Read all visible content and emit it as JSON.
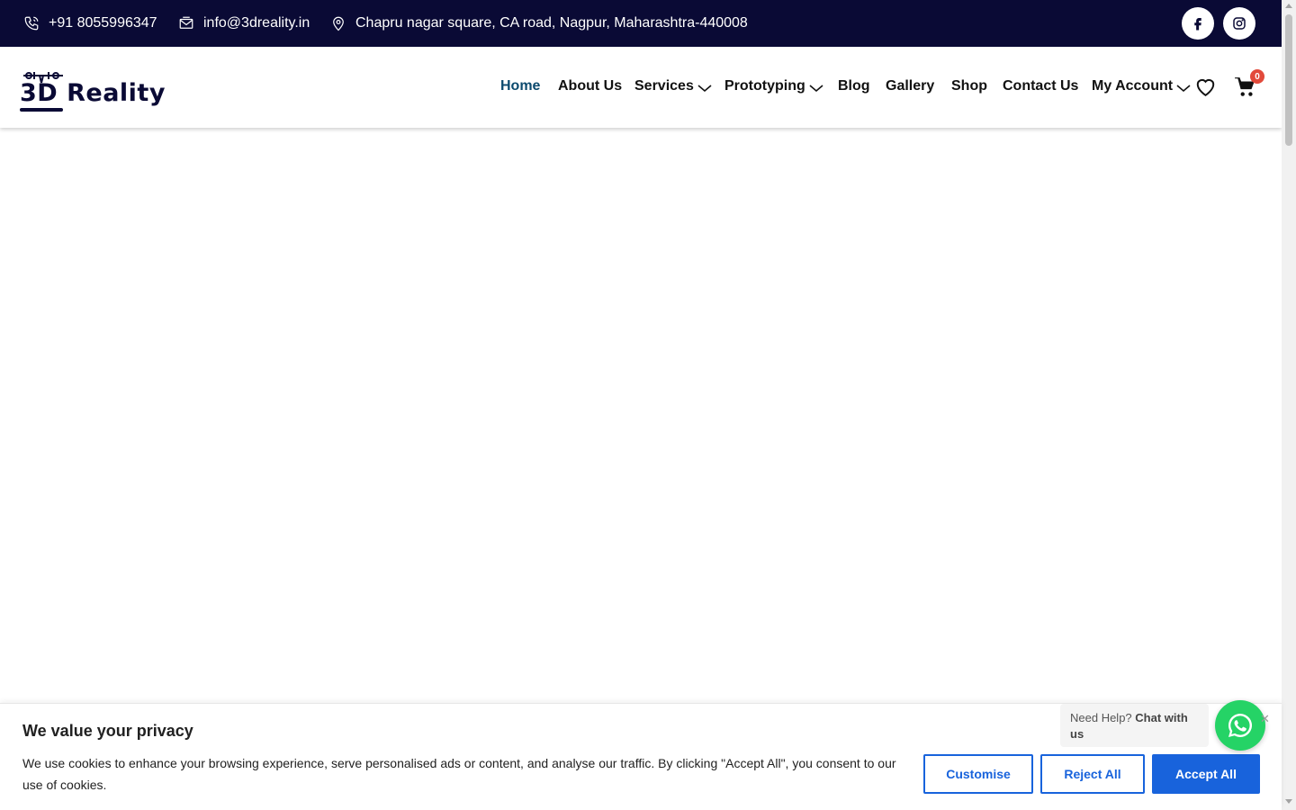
{
  "topbar": {
    "phone": "+91 8055996347",
    "email": "info@3dreality.in",
    "address": "Chapru nagar square, CA road, Nagpur, Maharashtra-440008",
    "social": [
      "facebook-icon",
      "instagram-icon"
    ]
  },
  "header": {
    "logo_text": "3D Reality",
    "nav": [
      {
        "label": "Home",
        "active": true
      },
      {
        "label": "About Us"
      },
      {
        "label": "Services",
        "dropdown": true
      },
      {
        "label": "Prototyping",
        "dropdown": true
      },
      {
        "label": "Blog"
      },
      {
        "label": "Gallery"
      },
      {
        "label": "Shop"
      },
      {
        "label": "Contact Us"
      },
      {
        "label": "My Account",
        "dropdown": true
      }
    ],
    "cart_count": "0"
  },
  "cookie": {
    "title": "We value your privacy",
    "text": "We use cookies to enhance your browsing experience, serve personalised ads or content, and analyse our traffic. By clicking \"Accept All\", you consent to our use of cookies.",
    "customise": "Customise",
    "reject": "Reject All",
    "accept": "Accept All"
  },
  "whatsapp": {
    "prefix": "Need Help? ",
    "bold": "Chat with us"
  },
  "colors": {
    "topbar_bg": "#0a0a35",
    "active_nav": "#0c4a6e",
    "cookie_button": "#1863dc",
    "whatsapp": "#25d366",
    "cart_badge": "#e24a3b"
  }
}
